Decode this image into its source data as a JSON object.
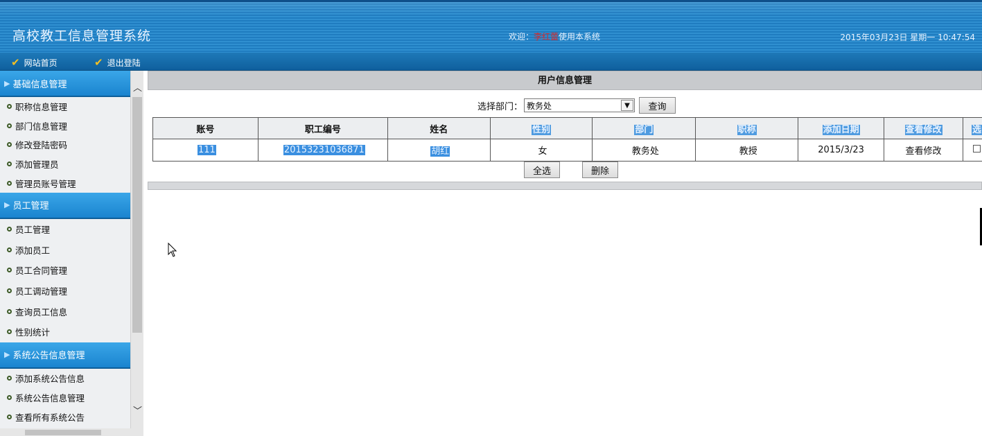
{
  "header": {
    "system_title": "高校教工信息管理系统",
    "welcome_prefix": "欢迎：",
    "welcome_user": "李红蕾",
    "welcome_suffix": "使用本系统",
    "datetime": "2015年03月23日 星期一 10:47:54"
  },
  "nav": {
    "home": "网站首页",
    "logout": "退出登陆"
  },
  "sidebar": {
    "groups": [
      {
        "title": "基础信息管理",
        "items": [
          "职称信息管理",
          "部门信息管理",
          "修改登陆密码",
          "添加管理员",
          "管理员账号管理"
        ]
      },
      {
        "title": "员工管理",
        "items": [
          "员工管理",
          "添加员工",
          "员工合同管理",
          "员工调动管理",
          "查询员工信息",
          "性别统计"
        ]
      },
      {
        "title": "系统公告信息管理",
        "items": [
          "添加系统公告信息",
          "系统公告信息管理",
          "查看所有系统公告"
        ]
      }
    ]
  },
  "main": {
    "panel_title": "用户信息管理",
    "filter_label": "选择部门：",
    "filter_value": "教务处",
    "query_button": "查询",
    "select_all_button": "全选",
    "delete_button": "删除",
    "table": {
      "headers": [
        "账号",
        "职工编号",
        "姓名",
        "性别",
        "部门",
        "职称",
        "添加日期",
        "查看修改",
        "选"
      ],
      "rows": [
        [
          "111",
          "20153231036871",
          "胡红",
          "女",
          "教务处",
          "教授",
          "2015/3/23",
          "查看修改"
        ]
      ]
    }
  },
  "colors": {
    "header_blue": "#1f7cc0",
    "sidebar_group": "#1a84cf",
    "selection_highlight": "#3a8fe0",
    "welcome_user": "#d62a2a"
  }
}
